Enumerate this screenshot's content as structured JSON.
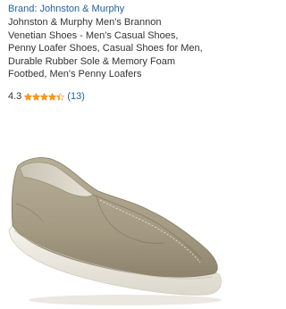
{
  "listing": {
    "brand_link": "Brand: Johnston & Murphy",
    "title_lines": [
      "Johnston & Murphy Men's Brannon",
      "Venetian Shoes - Men's Casual Shoes,",
      "Penny Loafer Shoes, Casual Shoes for Men,",
      "Durable Rubber Sole & Memory Foam",
      "Footbed, Men's Penny Loafers"
    ],
    "rating": {
      "value": "4.3",
      "stars_out_of_5": 4.3,
      "count": "(13)"
    },
    "image": {
      "subject": "taupe suede slip-on loafer with white rubber sole",
      "upper_color": "#a59b83",
      "sole_color": "#efece3"
    }
  },
  "colors": {
    "link": "#2162a1",
    "text": "#333333",
    "star": "#ff9900"
  }
}
